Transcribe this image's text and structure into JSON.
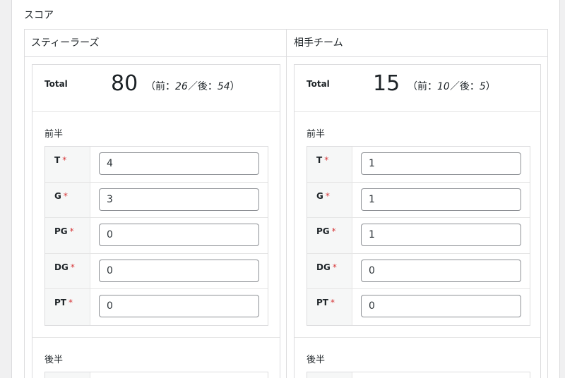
{
  "section_title": "スコア",
  "teams": [
    {
      "name": "スティーラーズ",
      "total_label": "Total",
      "total": "80",
      "detail_open": "（前：",
      "first_half_total": "26",
      "detail_sep": "／後：",
      "second_half_total": "54",
      "detail_close": "）",
      "first_half_title": "前半",
      "second_half_title": "後半",
      "fields": [
        {
          "label": "T",
          "value": "4"
        },
        {
          "label": "G",
          "value": "3"
        },
        {
          "label": "PG",
          "value": "0"
        },
        {
          "label": "DG",
          "value": "0"
        },
        {
          "label": "PT",
          "value": "0"
        }
      ]
    },
    {
      "name": "相手チーム",
      "total_label": "Total",
      "total": "15",
      "detail_open": "（前：",
      "first_half_total": "10",
      "detail_sep": "／後：",
      "second_half_total": "5",
      "detail_close": "）",
      "first_half_title": "前半",
      "second_half_title": "後半",
      "fields": [
        {
          "label": "T",
          "value": "1"
        },
        {
          "label": "G",
          "value": "1"
        },
        {
          "label": "PG",
          "value": "1"
        },
        {
          "label": "DG",
          "value": "0"
        },
        {
          "label": "PT",
          "value": "0"
        }
      ]
    }
  ],
  "required_mark": "*",
  "colors": {
    "required": "#d63638",
    "border": "#dcdcde",
    "label_bg": "#f6f7f7"
  }
}
